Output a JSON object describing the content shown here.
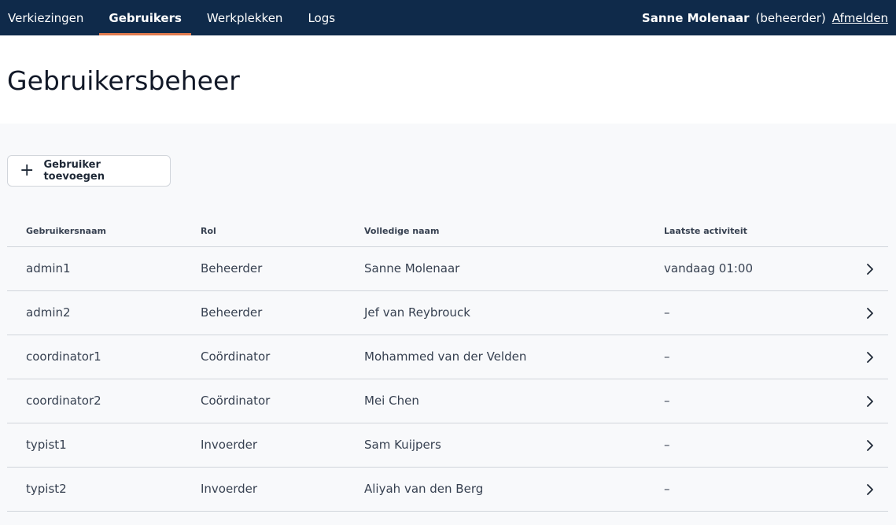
{
  "nav": {
    "items": [
      {
        "label": "Verkiezingen",
        "active": false
      },
      {
        "label": "Gebruikers",
        "active": true
      },
      {
        "label": "Werkplekken",
        "active": false
      },
      {
        "label": "Logs",
        "active": false
      }
    ]
  },
  "user": {
    "name": "Sanne Molenaar",
    "role": "(beheerder)",
    "logout": "Afmelden"
  },
  "page": {
    "title": "Gebruikersbeheer"
  },
  "actions": {
    "add_user": "Gebruiker toevoegen"
  },
  "table": {
    "headers": [
      "Gebruikersnaam",
      "Rol",
      "Volledige naam",
      "Laatste activiteit"
    ],
    "rows": [
      [
        "admin1",
        "Beheerder",
        "Sanne Molenaar",
        "vandaag 01:00"
      ],
      [
        "admin2",
        "Beheerder",
        "Jef van Reybrouck",
        "–"
      ],
      [
        "coordinator1",
        "Coördinator",
        "Mohammed van der Velden",
        "–"
      ],
      [
        "coordinator2",
        "Coördinator",
        "Mei Chen",
        "–"
      ],
      [
        "typist1",
        "Invoerder",
        "Sam Kuijpers",
        "–"
      ],
      [
        "typist2",
        "Invoerder",
        "Aliyah van den Berg",
        "–"
      ]
    ]
  },
  "colors": {
    "topbar": "#0f2a4a",
    "accent": "#e07b4f"
  }
}
